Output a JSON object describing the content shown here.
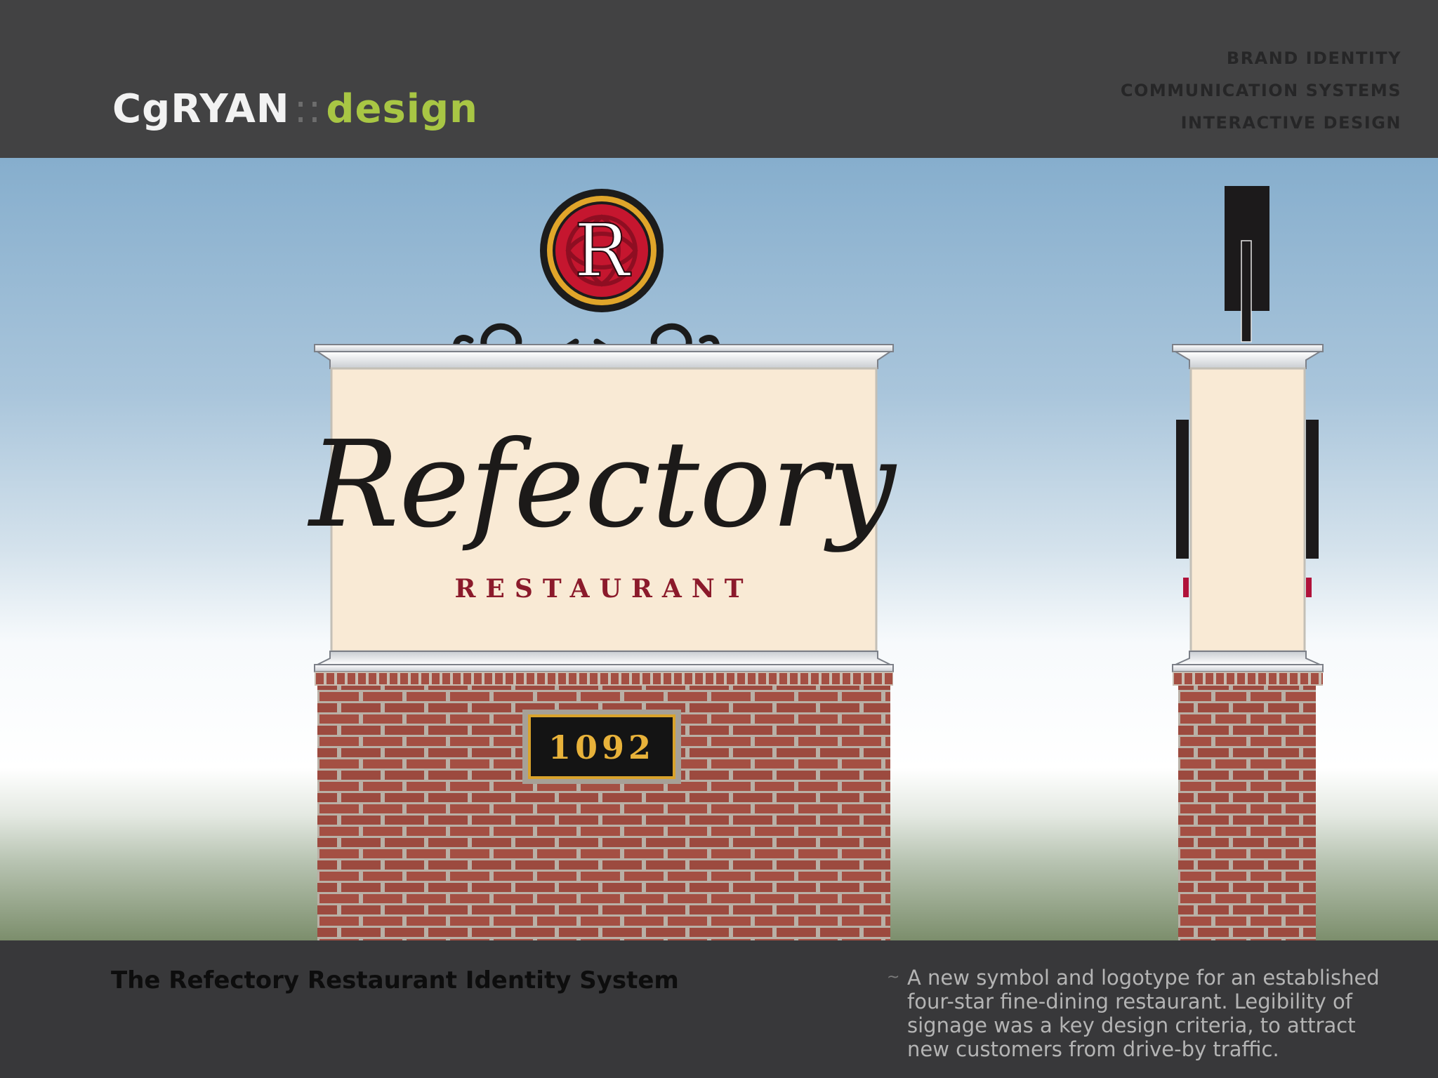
{
  "header": {
    "logo": {
      "part1": "Cg",
      "part2": "RYAN",
      "separator": "::",
      "part3": "design"
    },
    "services": [
      "BRAND IDENTITY",
      "COMMUNICATION SYSTEMS",
      "INTERACTIVE DESIGN"
    ]
  },
  "sign": {
    "emblem_letter": "R",
    "name": "Refectory",
    "subtitle": "RESTAURANT",
    "address_number": "1092"
  },
  "footer": {
    "title": "The Refectory Restaurant Identity System",
    "bullet": "~",
    "description": "A new symbol and logotype for an established four-star fine-dining restaurant. Legibility of signage was a key design criteria, to attract new customers from drive-by traffic."
  },
  "colors": {
    "header_bg": "#424243",
    "footer_bg": "#38383a",
    "logo_accent": "#a8c644",
    "brick": "#a44f43",
    "burgundy": "#8b1a2b",
    "cream": "#f9ead5",
    "gold": "#e0a52a"
  }
}
